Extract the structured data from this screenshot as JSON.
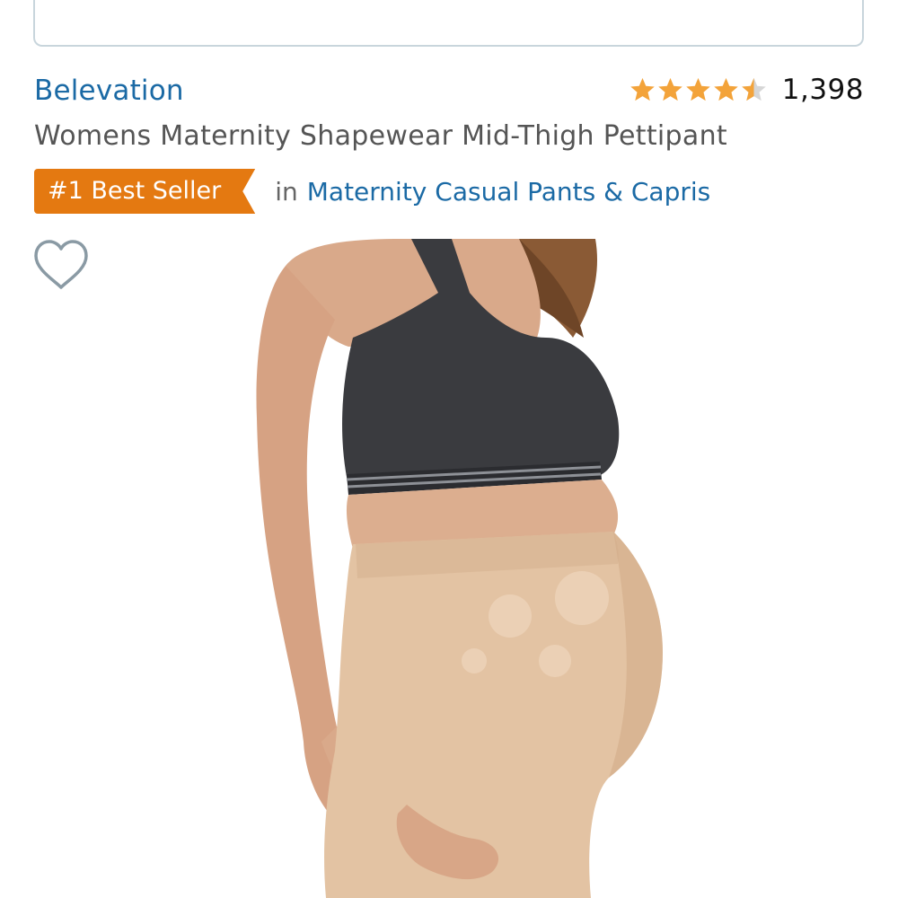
{
  "product": {
    "brand": "Belevation",
    "title": "Womens Maternity Shapewear Mid-Thigh Pettipant",
    "rating": 4.5,
    "rating_count": "1,398",
    "badge": "#1 Best Seller",
    "badge_in": "in",
    "category": "Maternity Casual Pants & Capris"
  },
  "colors": {
    "link": "#1b6aa5",
    "badge": "#e47911",
    "star": "#f3a33a",
    "star_empty": "#d6d6d6"
  },
  "icons": {
    "wishlist": "heart-outline-icon",
    "rating": "star-icon"
  }
}
